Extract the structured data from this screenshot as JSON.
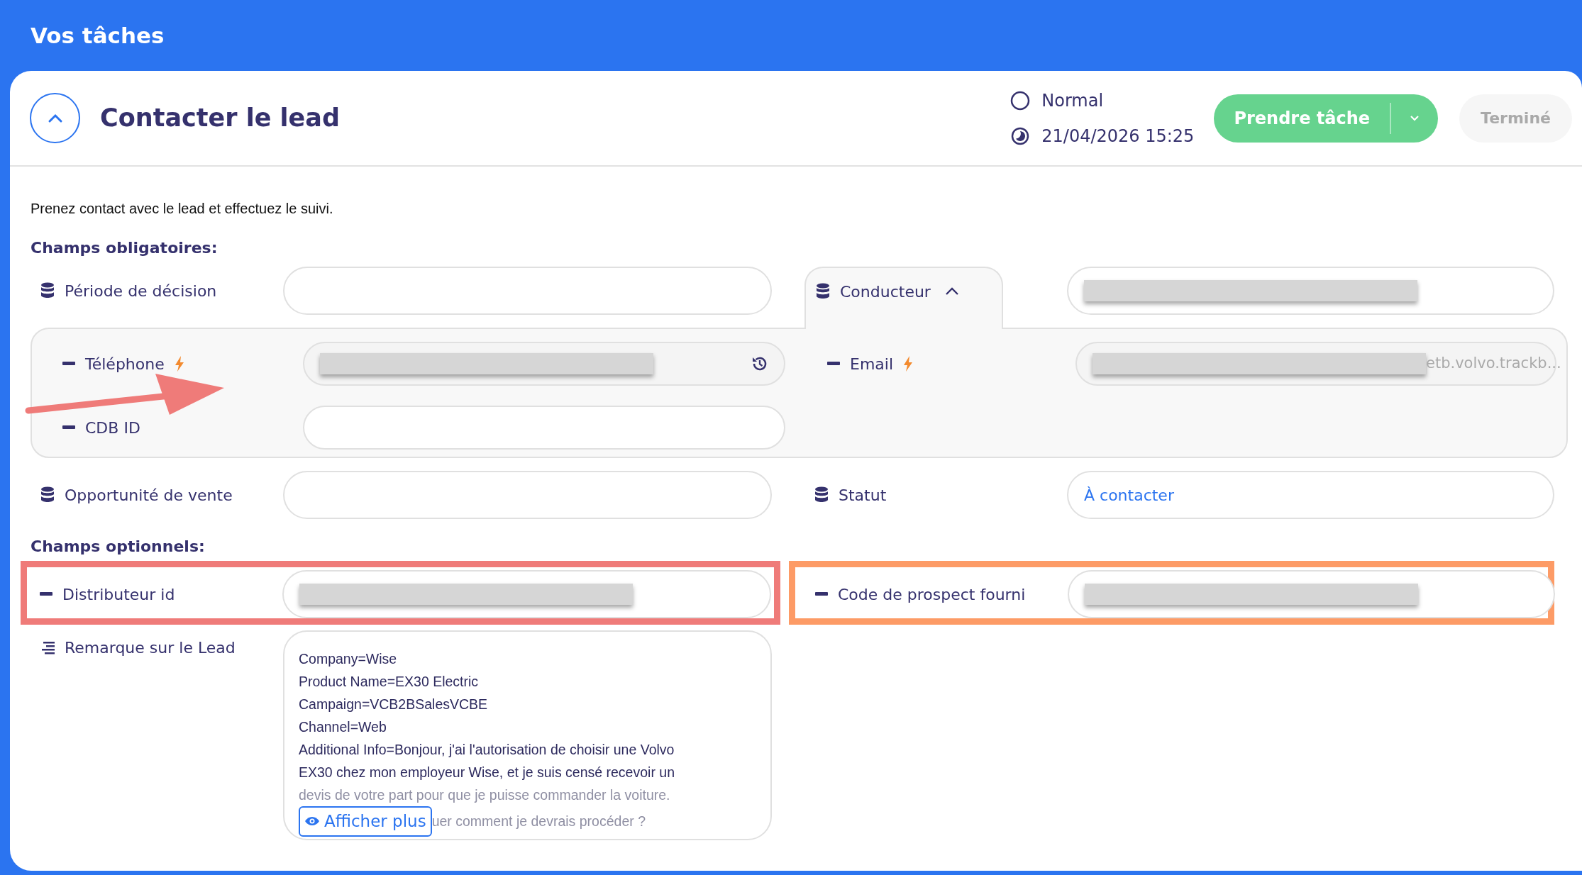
{
  "header": {
    "title": "Vos tâches"
  },
  "task": {
    "title": "Contacter le lead",
    "expanded": true,
    "priority": "Normal",
    "due": "21/04/2026 15:25",
    "take_button": "Prendre tâche",
    "done_button": {
      "label": "Terminé",
      "disabled": true
    }
  },
  "description": "Prenez contact avec le lead et effectuez le suivi.",
  "sections": [
    {
      "heading": "Champs obligatoires:",
      "rows": [
        {
          "kind": "pair",
          "left": {
            "kind": "linked",
            "label": "Période de décision"
          },
          "right": {
            "kind": "linked",
            "label": "Conducteur",
            "expanded": true,
            "redacted": true
          }
        },
        {
          "kind": "group",
          "left": [
            {
              "kind": "plain",
              "label": "Téléphone",
              "lightning": true,
              "readonly": true,
              "redacted": true,
              "history": true
            },
            {
              "kind": "plain",
              "label": "CDB ID"
            }
          ],
          "right": [
            {
              "kind": "plain",
              "label": "Email",
              "lightning": true,
              "readonly": true,
              "redacted": true,
              "value": "etb.volvo.trackb..."
            }
          ]
        },
        {
          "kind": "pair",
          "left": {
            "kind": "linked",
            "label": "Opportunité de vente"
          },
          "right": {
            "kind": "linked",
            "label": "Statut",
            "value": "À contacter"
          }
        }
      ]
    },
    {
      "heading": "Champs optionnels:",
      "rows": [
        {
          "kind": "pair",
          "left": {
            "kind": "plain",
            "label": "Distributeur id",
            "redacted": true,
            "color": "#ef7b79"
          },
          "right": {
            "kind": "plain",
            "label": "Code de prospect fourni",
            "redacted": true,
            "color": "#fd9b66"
          }
        },
        {
          "kind": "note",
          "left": {
            "kind": "text",
            "label": "Remarque sur le Lead",
            "lines": [
              {
                "text": "Company=Wise",
                "faded": false
              },
              {
                "text": "Product Name=EX30 Electric",
                "faded": false
              },
              {
                "text": "Campaign=VCB2BSalesVCBE",
                "faded": false
              },
              {
                "text": "Channel=Web",
                "faded": false
              },
              {
                "text": "Additional Info=Bonjour, j'ai l'autorisation de choisir une Volvo",
                "faded": false
              },
              {
                "text": "EX30 chez mon employeur Wise, et je suis censé recevoir un",
                "faded": false
              },
              {
                "text": "devis de votre part pour que je puisse commander la voiture.",
                "faded": true
              }
            ],
            "more_button": "Afficher plus",
            "trailing_text": "uer comment je devrais procéder ?"
          }
        }
      ]
    }
  ],
  "annotations": [
    {
      "kind": "arrow",
      "color": "#ef7b79"
    }
  ]
}
